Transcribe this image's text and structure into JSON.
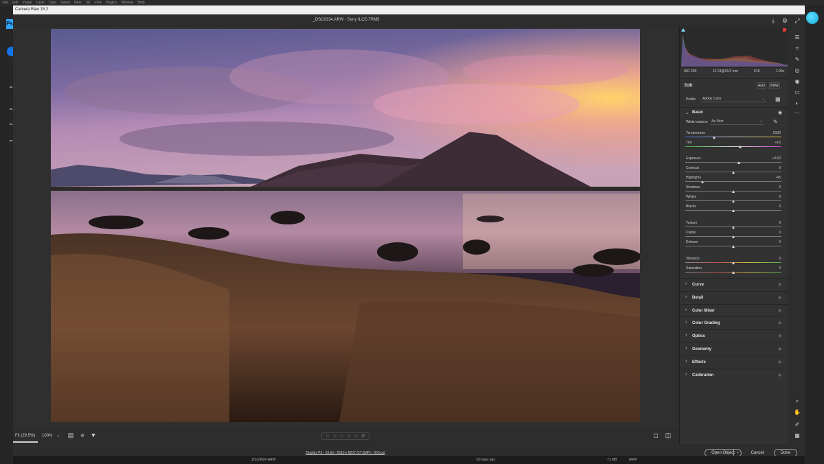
{
  "photoshop": {
    "menu": [
      "File",
      "Edit",
      "Image",
      "Layer",
      "Type",
      "Select",
      "Filter",
      "3D",
      "View",
      "Plugins",
      "Window",
      "Help"
    ],
    "logo": "Ps"
  },
  "dialog": {
    "title": "Camera Raw 15.2",
    "filename": "_DSC0334.ARW  ·  Sony ILCE-7RM5"
  },
  "canvas_toolbar": {
    "zoom_fit": "Fit (29.5%)",
    "zoom_100": "100%",
    "rating_stars": 5
  },
  "footer": {
    "file_info": "Display P3 - 16 bit - 9310 x 6207 (57.8MP) - 300 ppi",
    "open_object": "Open Object",
    "cancel": "Cancel",
    "done": "Done"
  },
  "filmstrip": {
    "name": "_DSC4924.ARW",
    "date": "20 days ago",
    "size": "71 MB",
    "type": "ARW"
  },
  "histogram_meta": {
    "iso": "ISO 200",
    "lens": "12-24@15.0 mm",
    "aperture": "f/16",
    "shutter": "1.00s"
  },
  "edit_panel": {
    "title": "Edit",
    "auto_label": "Auto",
    "bw_label": "B&W",
    "profile_label": "Profile",
    "profile_value": "Adobe Color",
    "basic_title": "Basic",
    "white_balance_label": "White balance",
    "white_balance_value": "As Shot",
    "sliders": [
      {
        "label": "Temperature",
        "value": "5100",
        "pos": 0.3
      },
      {
        "label": "Tint",
        "value": "+15",
        "pos": 0.57
      },
      {
        "label": "Exposure",
        "value": "+0.60",
        "pos": 0.56
      },
      {
        "label": "Contrast",
        "value": "0",
        "pos": 0.5
      },
      {
        "label": "Highlights",
        "value": "-65",
        "pos": 0.18
      },
      {
        "label": "Shadows",
        "value": "0",
        "pos": 0.5
      },
      {
        "label": "Whites",
        "value": "0",
        "pos": 0.5
      },
      {
        "label": "Blacks",
        "value": "0",
        "pos": 0.5
      },
      {
        "label": "Texture",
        "value": "0",
        "pos": 0.5
      },
      {
        "label": "Clarity",
        "value": "0",
        "pos": 0.5
      },
      {
        "label": "Dehaze",
        "value": "0",
        "pos": 0.5
      },
      {
        "label": "Vibrance",
        "value": "0",
        "pos": 0.5
      },
      {
        "label": "Saturation",
        "value": "0",
        "pos": 0.5
      }
    ],
    "sections": [
      "Curve",
      "Detail",
      "Color Mixer",
      "Color Grading",
      "Optics",
      "Geometry",
      "Effects",
      "Calibration"
    ]
  },
  "colors": {
    "accent": "#1473e6",
    "panel_bg": "#323232"
  }
}
